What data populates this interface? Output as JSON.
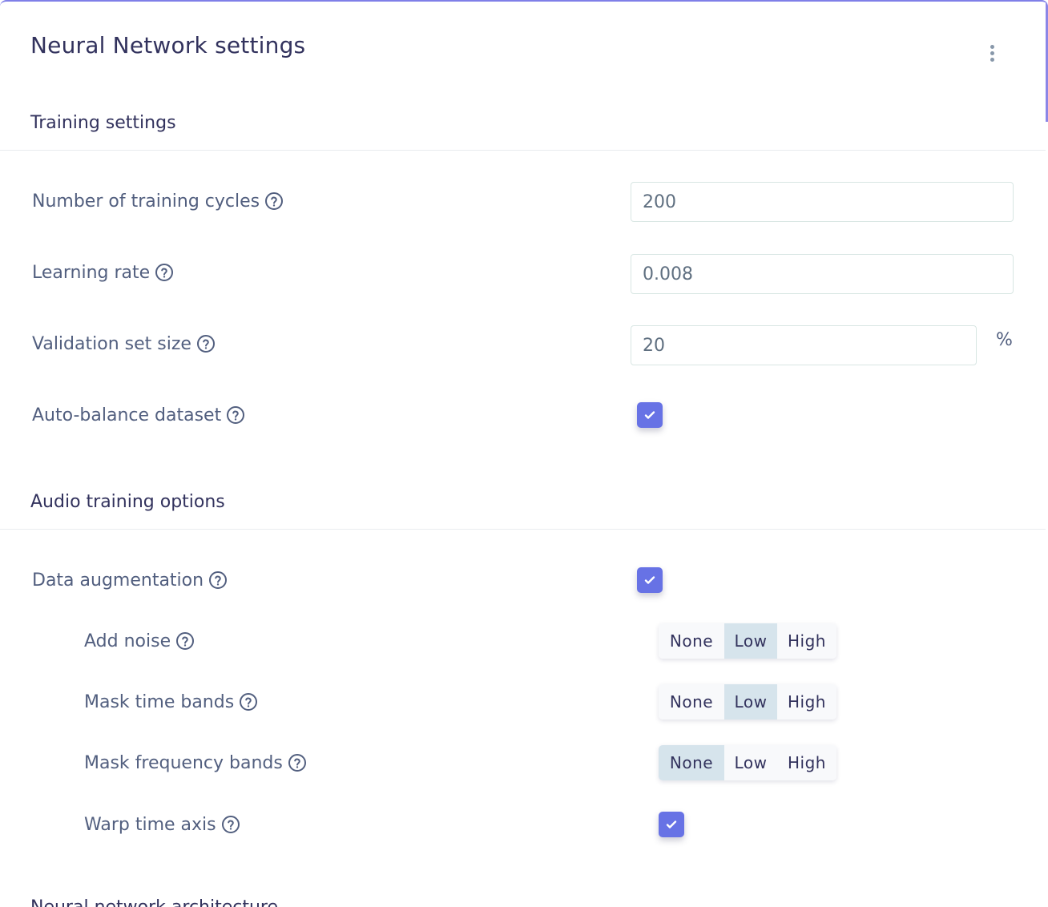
{
  "title": "Neural Network settings",
  "menu_icon": "kebab-vertical-icon",
  "accent_color": "#6772e5",
  "sections": {
    "training": {
      "title": "Training settings",
      "training_cycles": {
        "label": "Number of training cycles",
        "value": "200"
      },
      "learning_rate": {
        "label": "Learning rate",
        "value": "0.008"
      },
      "validation_size": {
        "label": "Validation set size",
        "value": "20",
        "suffix": "%"
      },
      "auto_balance": {
        "label": "Auto-balance dataset",
        "checked": true
      }
    },
    "audio": {
      "title": "Audio training options",
      "data_augmentation": {
        "label": "Data augmentation",
        "checked": true
      },
      "add_noise": {
        "label": "Add noise",
        "options": [
          "None",
          "Low",
          "High"
        ],
        "selected": "Low"
      },
      "mask_time": {
        "label": "Mask time bands",
        "options": [
          "None",
          "Low",
          "High"
        ],
        "selected": "Low"
      },
      "mask_freq": {
        "label": "Mask frequency bands",
        "options": [
          "None",
          "Low",
          "High"
        ],
        "selected": "None"
      },
      "warp_time": {
        "label": "Warp time axis",
        "checked": true
      }
    },
    "architecture": {
      "title": "Neural network architecture"
    }
  }
}
